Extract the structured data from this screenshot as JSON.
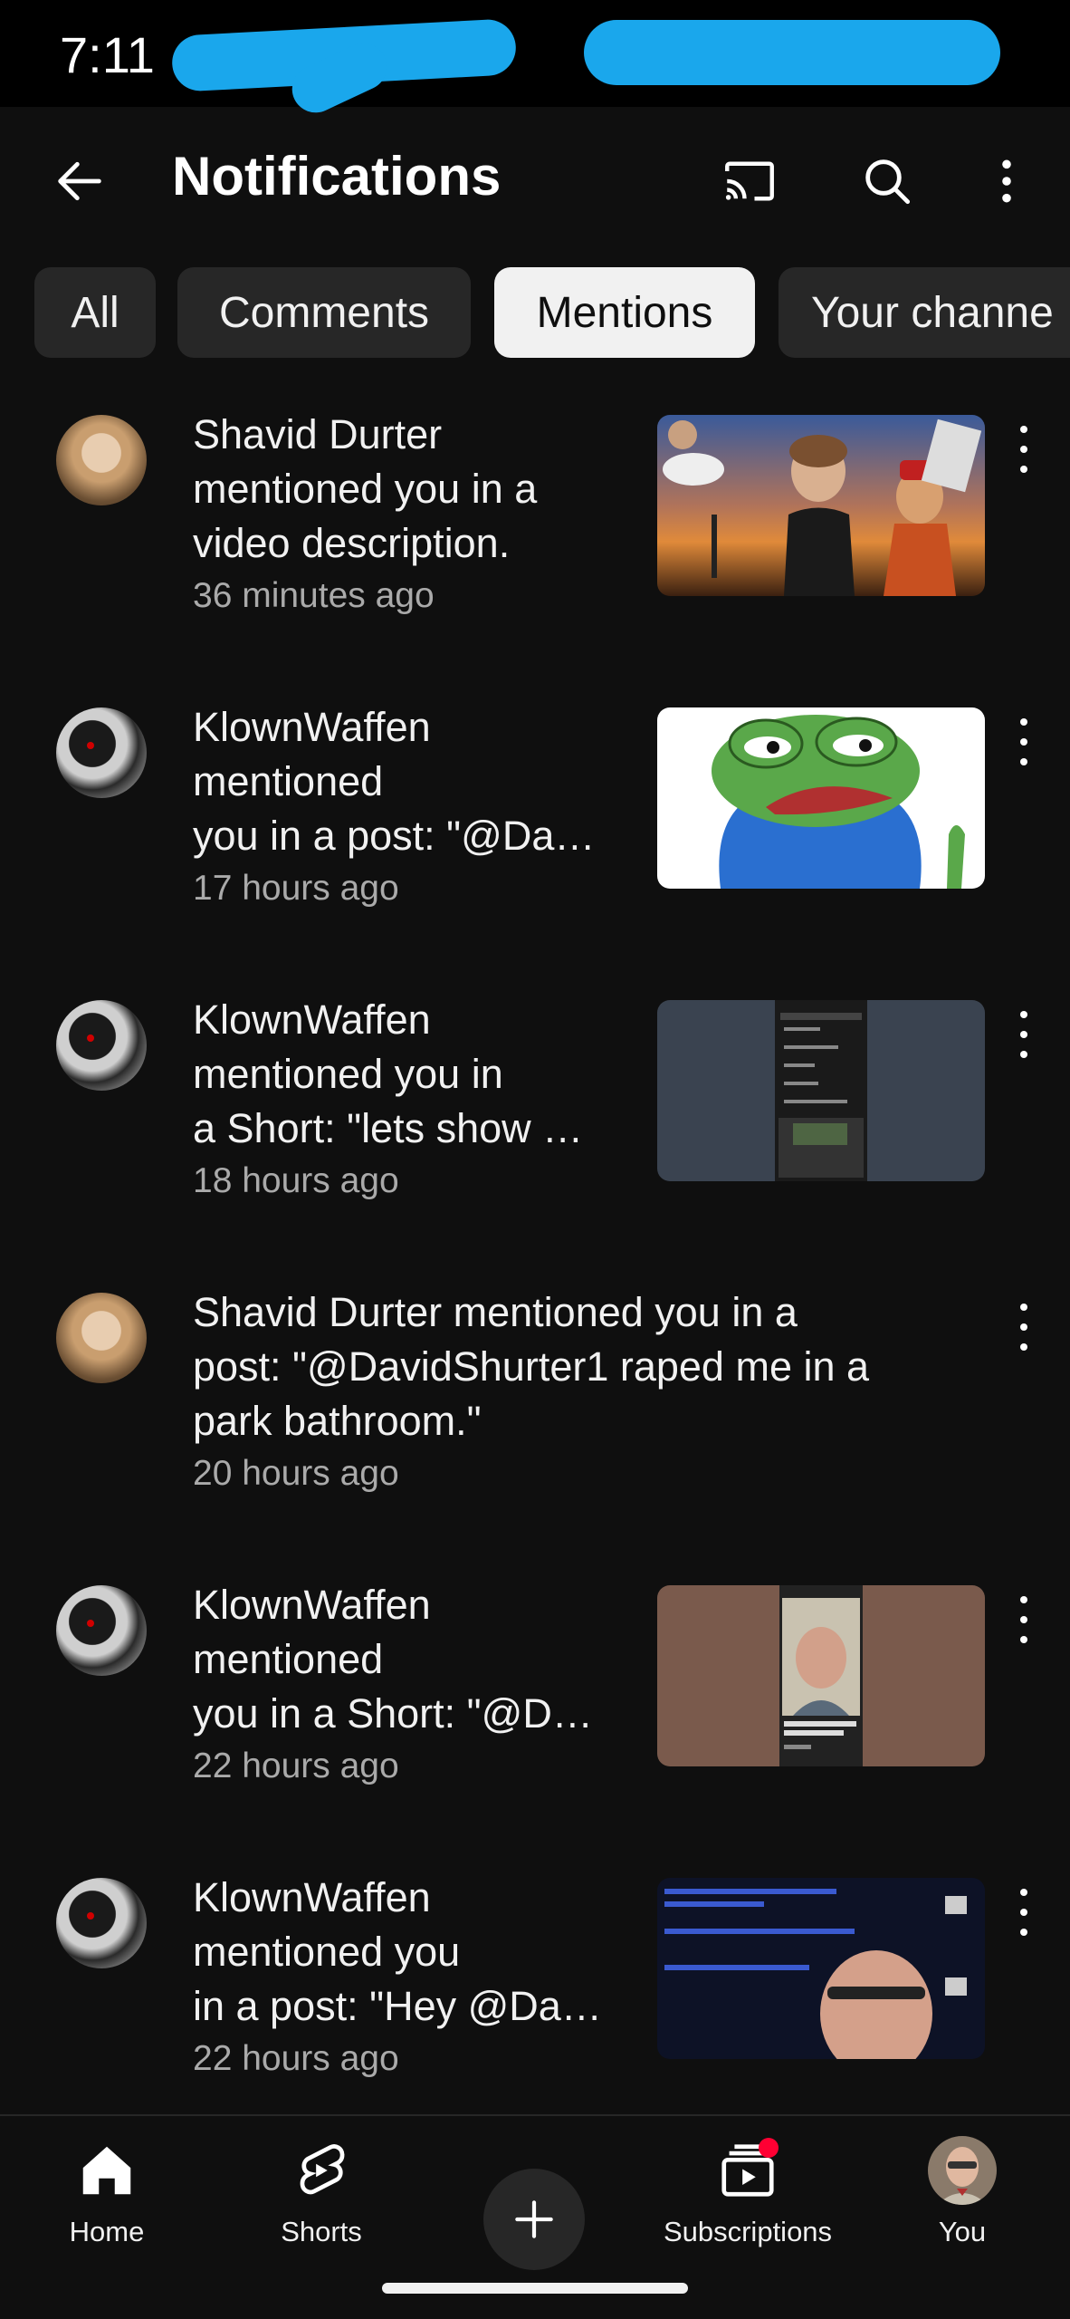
{
  "status_bar": {
    "time": "7:11"
  },
  "header": {
    "title": "Notifications",
    "back_icon": "arrow-left-icon",
    "cast_icon": "cast-icon",
    "search_icon": "search-icon",
    "more_icon": "more-vert-icon"
  },
  "chips": [
    {
      "label": "All",
      "active": false
    },
    {
      "label": "Comments",
      "active": false
    },
    {
      "label": "Mentions",
      "active": true
    },
    {
      "label": "Your channe",
      "active": false
    }
  ],
  "notifications": [
    {
      "user": "Shavid Durter",
      "line1": "Shavid Durter",
      "line2": "mentioned you in a",
      "line3": "video description.",
      "time": "36 minutes ago",
      "avatar": "child",
      "thumb": "collage"
    },
    {
      "user": "KlownWaffen",
      "line1": "KlownWaffen",
      "line2": "mentioned",
      "line3": "you in a post: \"@Da…",
      "time": "17 hours ago",
      "avatar": "klown",
      "thumb": "frog"
    },
    {
      "user": "KlownWaffen",
      "line1": "KlownWaffen",
      "line2": "mentioned you in",
      "line3": "a Short: \"lets show …",
      "time": "18 hours ago",
      "avatar": "klown",
      "thumb": "phone-screen"
    },
    {
      "user": "Shavid Durter",
      "line1": "Shavid Durter mentioned you in a",
      "line2": "post: \"@DavidShurter1 raped me in a",
      "line3": "park bathroom.\"",
      "time": "20 hours ago",
      "avatar": "child",
      "thumb": ""
    },
    {
      "user": "KlownWaffen",
      "line1": "KlownWaffen",
      "line2": "mentioned",
      "line3": "you in a Short: \"@D…",
      "time": "22 hours ago",
      "avatar": "klown",
      "thumb": "portrait"
    },
    {
      "user": "KlownWaffen",
      "line1": "KlownWaffen",
      "line2": "mentioned you",
      "line3": "in a post: \"Hey @Da…",
      "time": "22 hours ago",
      "avatar": "klown",
      "thumb": "screenshot"
    }
  ],
  "bottom_nav": [
    {
      "label": "Home",
      "icon": "home-icon"
    },
    {
      "label": "Shorts",
      "icon": "shorts-icon"
    },
    {
      "label": "",
      "icon": "plus-icon"
    },
    {
      "label": "Subscriptions",
      "icon": "subscriptions-icon"
    },
    {
      "label": "You",
      "icon": "avatar"
    }
  ],
  "colors": {
    "background": "#0f0f0f",
    "chip": "#272727",
    "chip_active": "#f1f1f1",
    "secondary_text": "#aaaaaa",
    "badge": "#ff0033",
    "scribble": "#1aa7ec"
  }
}
